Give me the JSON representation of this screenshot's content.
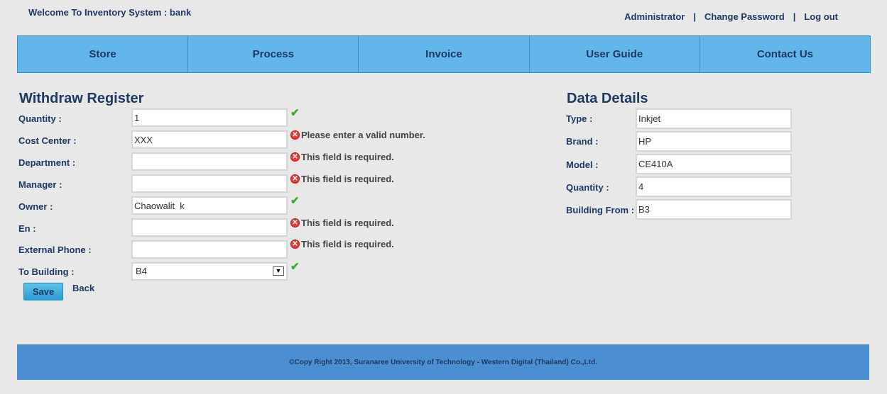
{
  "header": {
    "welcome": "Welcome To Inventory System : bank",
    "links": [
      "Administrator",
      "Change Password",
      "Log out"
    ],
    "separator": "|"
  },
  "nav": [
    "Store",
    "Process",
    "Invoice",
    "User Guide",
    "Contact Us"
  ],
  "form": {
    "title": "Withdraw Register",
    "rows": [
      {
        "label": "Quantity :",
        "value": "1",
        "status": "ok",
        "message": ""
      },
      {
        "label": "Cost Center :",
        "value": "XXX",
        "status": "error",
        "message": "Please enter a valid number."
      },
      {
        "label": "Department :",
        "value": "",
        "status": "error",
        "message": "This field is required."
      },
      {
        "label": "Manager :",
        "value": "",
        "status": "error",
        "message": "This field is required."
      },
      {
        "label": "Owner :",
        "value": "Chaowalit  k",
        "status": "ok",
        "message": ""
      },
      {
        "label": "En :",
        "value": "",
        "status": "error",
        "message": "This field is required."
      },
      {
        "label": "External Phone :",
        "value": "",
        "status": "error",
        "message": "This field is required."
      },
      {
        "label": "To Building :",
        "value": "B4",
        "status": "ok",
        "message": ""
      }
    ],
    "save_label": "Save",
    "back_label": "Back",
    "icons": {
      "ok": "checkmark-icon",
      "error": "error-x-icon",
      "dropdown": "dropdown-arrow-icon"
    }
  },
  "details": {
    "title": "Data Details",
    "rows": [
      {
        "label": "Type :",
        "value": "Inkjet"
      },
      {
        "label": "Brand :",
        "value": "HP"
      },
      {
        "label": "Model :",
        "value": "CE410A"
      },
      {
        "label": "Quantity :",
        "value": "4"
      },
      {
        "label": "Building From :",
        "value": "B3"
      }
    ]
  },
  "footer": {
    "text": "©Copy Right 2013, Suranaree University of Technology - Western Digital (Thailand) Co.,Ltd."
  },
  "colors": {
    "nav_bg": "#62b6ea",
    "footer_bg": "#4b8fd2",
    "text": "#1f3864",
    "ok": "#34a82f",
    "error": "#e43b3b"
  }
}
